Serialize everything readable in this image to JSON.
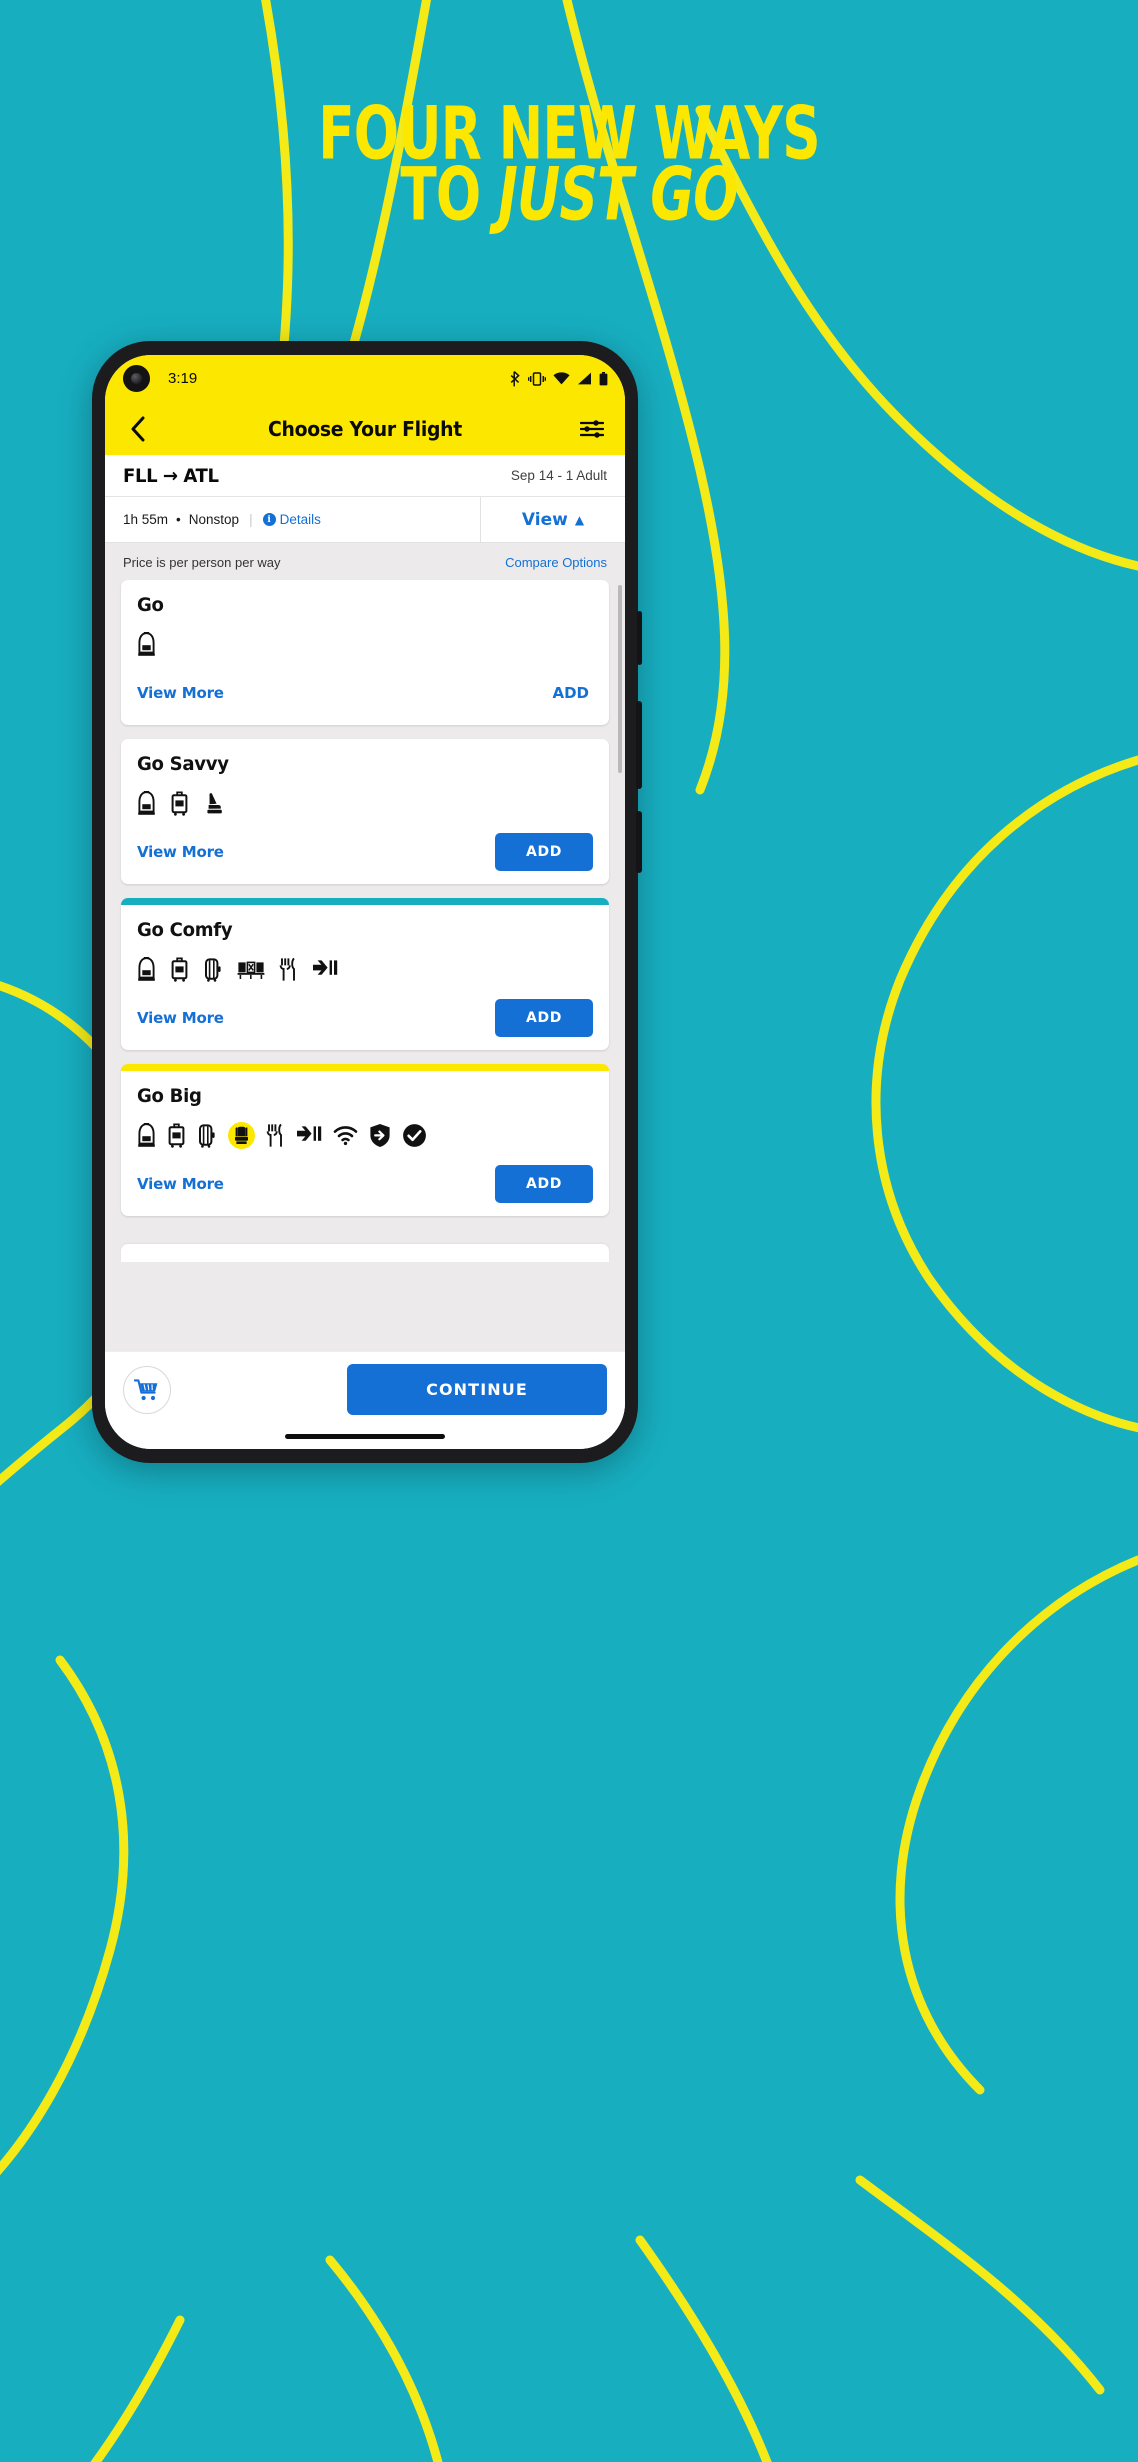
{
  "promo": {
    "headline_line1": "FOUR NEW WAYS",
    "headline_line2_prefix": "TO ",
    "headline_line2_italic": "JUST GO",
    "background_color": "#17aec0",
    "accent_color": "#fbe700"
  },
  "status_bar": {
    "time": "3:19",
    "icons": [
      "bluetooth-icon",
      "vibrate-icon",
      "wifi-icon",
      "signal-icon",
      "battery-icon"
    ]
  },
  "app_bar": {
    "back_icon": "chevron-left-icon",
    "title": "Choose Your Flight",
    "filter_icon": "filter-sliders-icon"
  },
  "route": {
    "origin": "FLL",
    "arrow": "→",
    "destination": "ATL",
    "date_passengers": "Sep 14 - 1 Adult"
  },
  "flight_summary": {
    "duration": "1h 55m",
    "separator_dot": "•",
    "stops": "Nonstop",
    "details_label": "Details",
    "details_icon": "info-icon",
    "view_label": "View",
    "view_caret": "▲"
  },
  "price_note": {
    "text": "Price is per person per way",
    "compare_label": "Compare Options"
  },
  "fares": [
    {
      "name": "Go",
      "accent": "none",
      "icons": [
        "personal-item-icon"
      ],
      "view_more": "View More",
      "add_label": "ADD",
      "add_style": "link"
    },
    {
      "name": "Go Savvy",
      "accent": "none",
      "icons": [
        "personal-item-icon",
        "carry-on-bag-icon",
        "seat-selection-icon"
      ],
      "view_more": "View More",
      "add_label": "ADD",
      "add_style": "button"
    },
    {
      "name": "Go Comfy",
      "accent": "#17aec0",
      "icons": [
        "personal-item-icon",
        "carry-on-bag-icon",
        "checked-bag-icon",
        "blocked-middle-seat-icon",
        "meal-icon",
        "priority-boarding-icon"
      ],
      "view_more": "View More",
      "add_label": "ADD",
      "add_style": "button"
    },
    {
      "name": "Go Big",
      "accent": "#fbe700",
      "icons": [
        "personal-item-icon",
        "carry-on-bag-icon",
        "checked-bag-icon",
        "premium-seat-icon",
        "meal-icon",
        "priority-boarding-icon",
        "wifi-icon",
        "flexibility-shield-icon",
        "check-circle-icon"
      ],
      "view_more": "View More",
      "add_label": "ADD",
      "add_style": "button"
    }
  ],
  "bottom_bar": {
    "cart_icon": "shopping-cart-icon",
    "continue_label": "CONTINUE"
  },
  "colors": {
    "brand_yellow": "#fbe700",
    "brand_teal": "#17aec0",
    "action_blue": "#1470d4"
  }
}
